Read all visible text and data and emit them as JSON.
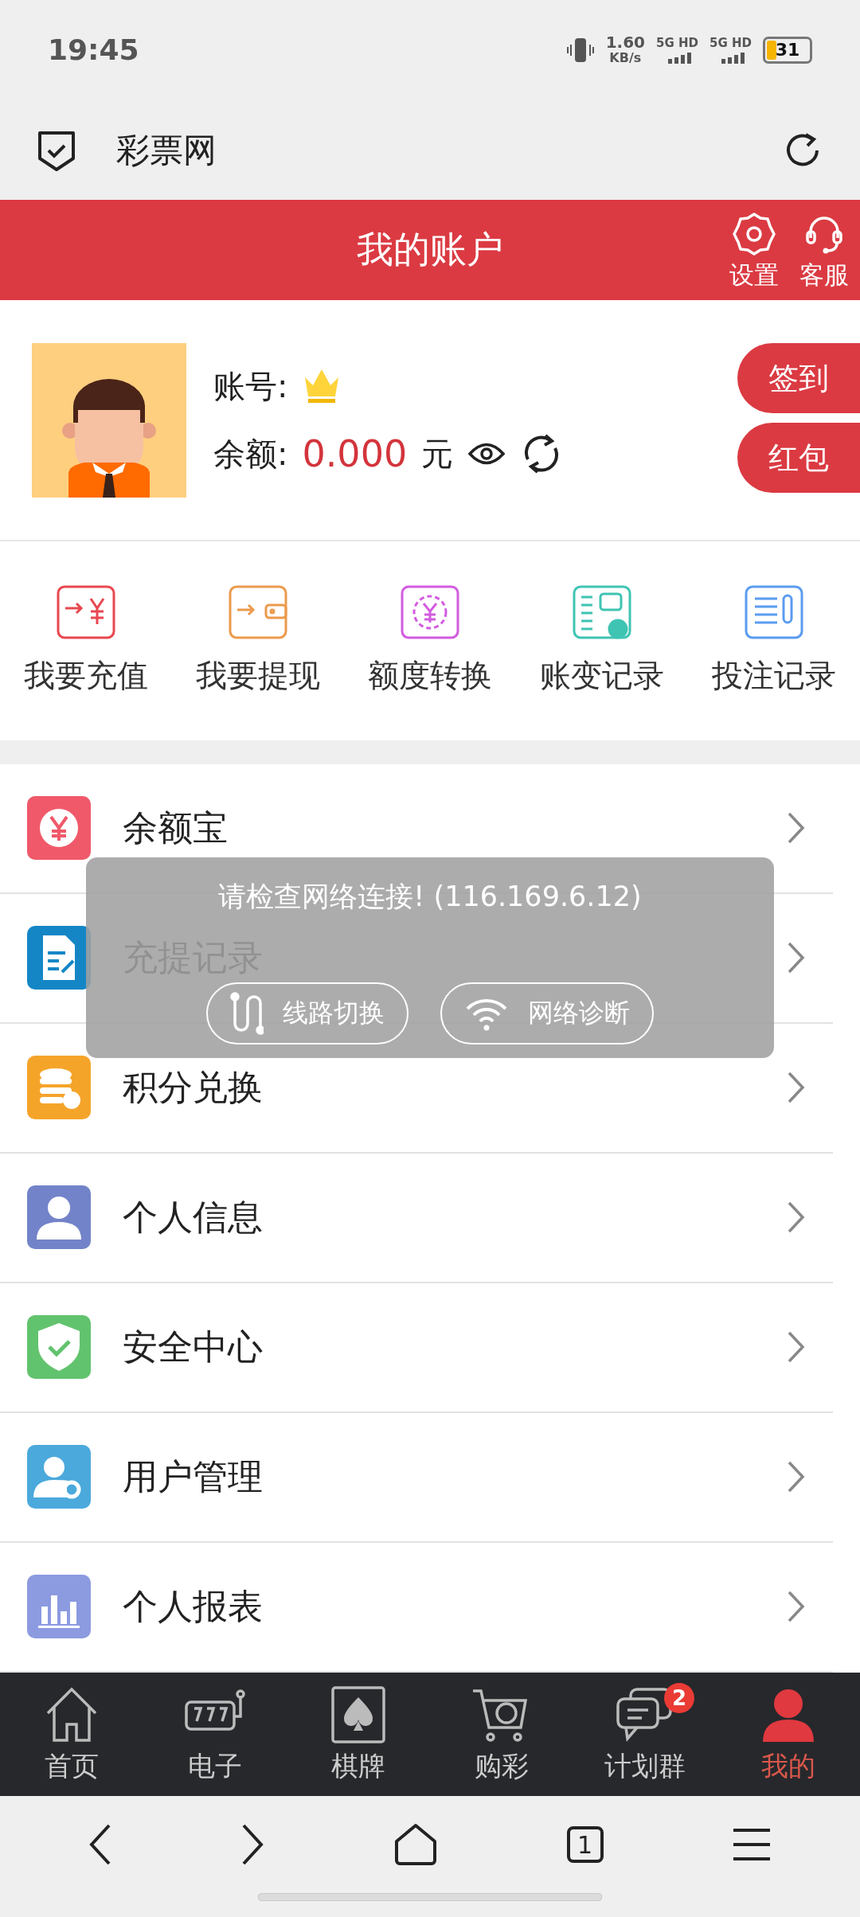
{
  "status_bar": {
    "time": "19:45",
    "speed": "1.60",
    "speed_unit": "KB/s",
    "networks": [
      "5G HD",
      "5G HD"
    ],
    "battery": "31"
  },
  "browser_bar": {
    "title": "彩票网"
  },
  "header": {
    "title": "我的账户",
    "actions": [
      {
        "label": "设置",
        "kind": "settings"
      },
      {
        "label": "客服",
        "kind": "support"
      }
    ]
  },
  "account": {
    "account_label": "账号:",
    "balance_label": "余额:",
    "balance": "0.000",
    "unit": "元",
    "buttons": [
      "签到",
      "红包"
    ]
  },
  "quick_actions": [
    {
      "label": "我要充值",
      "kind": "deposit",
      "color": "#e8474f"
    },
    {
      "label": "我要提现",
      "kind": "withdraw",
      "color": "#ec9a4c"
    },
    {
      "label": "额度转换",
      "kind": "transfer",
      "color": "#d25be0"
    },
    {
      "label": "账变记录",
      "kind": "ledger",
      "color": "#3fc4b3"
    },
    {
      "label": "投注记录",
      "kind": "bets",
      "color": "#5a9cf0"
    }
  ],
  "menu": [
    {
      "label": "余额宝",
      "kind": "yen",
      "color": "#f0596a"
    },
    {
      "label": "充提记录",
      "kind": "doc",
      "color": "#1486c6"
    },
    {
      "label": "积分兑换",
      "kind": "coins",
      "color": "#f5a42a"
    },
    {
      "label": "个人信息",
      "kind": "user",
      "color": "#7383c9"
    },
    {
      "label": "安全中心",
      "kind": "shield",
      "color": "#62c36e"
    },
    {
      "label": "用户管理",
      "kind": "usergear",
      "color": "#4ba9dc"
    },
    {
      "label": "个人报表",
      "kind": "chart",
      "color": "#8c9ae0"
    }
  ],
  "toast": {
    "message": "请检查网络连接! (116.169.6.12)",
    "buttons": [
      {
        "label": "线路切换",
        "kind": "route"
      },
      {
        "label": "网络诊断",
        "kind": "wifi"
      }
    ]
  },
  "tab_bar": [
    {
      "label": "首页",
      "kind": "home",
      "selected": false
    },
    {
      "label": "电子",
      "kind": "slots",
      "selected": false
    },
    {
      "label": "棋牌",
      "kind": "cards",
      "selected": false
    },
    {
      "label": "购彩",
      "kind": "cart",
      "selected": false
    },
    {
      "label": "计划群",
      "kind": "chat",
      "selected": false,
      "badge": "2"
    },
    {
      "label": "我的",
      "kind": "me",
      "selected": true
    }
  ],
  "browser_nav": {
    "tab_count": "1"
  }
}
